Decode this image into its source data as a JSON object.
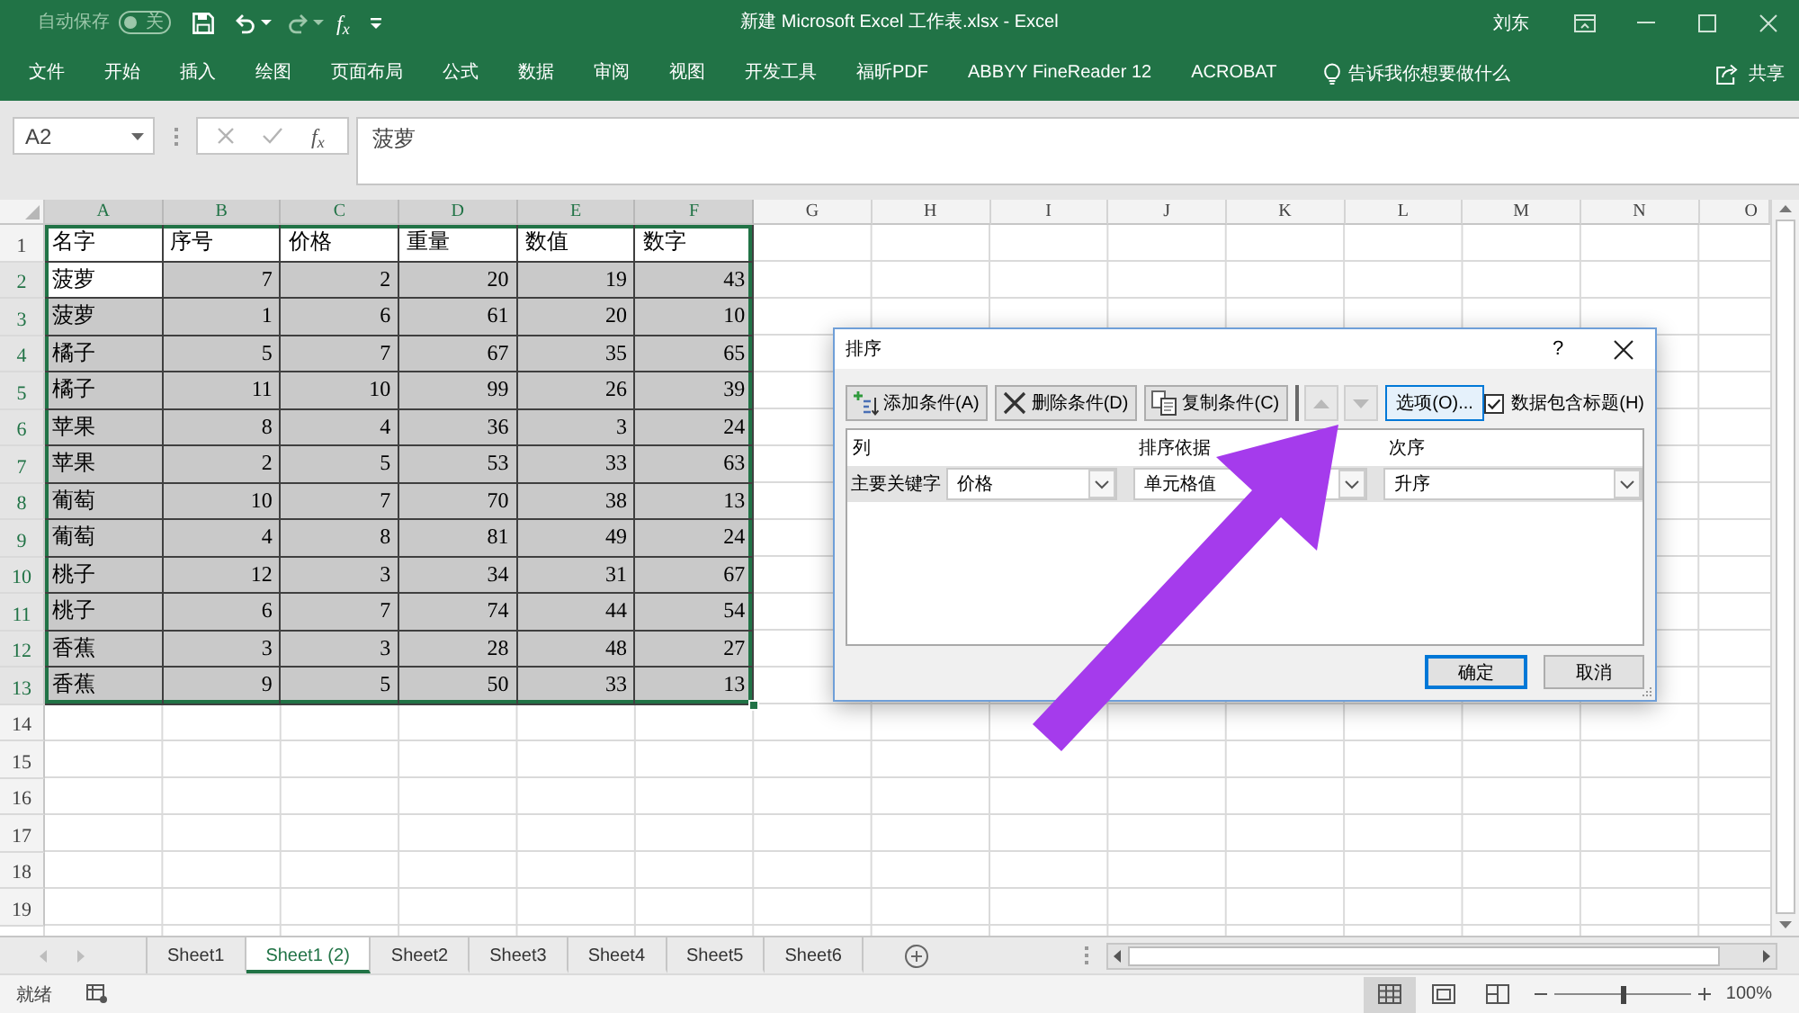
{
  "title_bar": {
    "autosave": {
      "label": "自动保存",
      "state_text": "关",
      "on": false
    },
    "function_label": "f$_{x}$",
    "title": "新建 Microsoft Excel 工作表.xlsx - Excel",
    "user": "刘东"
  },
  "ribbon": {
    "tabs": [
      "文件",
      "开始",
      "插入",
      "绘图",
      "页面布局",
      "公式",
      "数据",
      "审阅",
      "视图",
      "开发工具",
      "福昕PDF",
      "ABBYY FineReader 12",
      "ACROBAT"
    ],
    "tell_me": "告诉我你想要做什么",
    "share": "共享"
  },
  "formula_bar": {
    "name_box": "A2",
    "function_label": "f$_{x}$",
    "formula": "菠萝"
  },
  "sheet": {
    "columns": [
      {
        "label": "A",
        "selected": true,
        "kind": "text"
      },
      {
        "label": "B",
        "selected": true,
        "kind": "number"
      },
      {
        "label": "C",
        "selected": true,
        "kind": "number"
      },
      {
        "label": "D",
        "selected": true,
        "kind": "number"
      },
      {
        "label": "E",
        "selected": true,
        "kind": "number"
      },
      {
        "label": "F",
        "selected": true,
        "kind": "number"
      },
      {
        "label": "G",
        "selected": false
      },
      {
        "label": "H",
        "selected": false
      },
      {
        "label": "I",
        "selected": false
      },
      {
        "label": "J",
        "selected": false
      },
      {
        "label": "K",
        "selected": false
      },
      {
        "label": "L",
        "selected": false
      },
      {
        "label": "M",
        "selected": false
      },
      {
        "label": "N",
        "selected": false
      },
      {
        "label": "O",
        "selected": false
      }
    ],
    "rows": [
      {
        "number": "1",
        "kind": "header",
        "selected": false,
        "cells": [
          {
            "text": "名字",
            "selected": false
          },
          {
            "text": "序号",
            "selected": false
          },
          {
            "text": "价格",
            "selected": false
          },
          {
            "text": "重量",
            "selected": false
          },
          {
            "text": "数值",
            "selected": false
          },
          {
            "text": "数字",
            "selected": false
          }
        ]
      },
      {
        "number": "2",
        "kind": "data",
        "selected": true,
        "cells": [
          {
            "text": "菠萝",
            "selected": false
          },
          {
            "text": "7",
            "selected": true
          },
          {
            "text": "2",
            "selected": true
          },
          {
            "text": "20",
            "selected": true
          },
          {
            "text": "19",
            "selected": true
          },
          {
            "text": "43",
            "selected": true
          }
        ]
      },
      {
        "number": "3",
        "kind": "data",
        "selected": true,
        "cells": [
          {
            "text": "菠萝",
            "selected": true
          },
          {
            "text": "1",
            "selected": true
          },
          {
            "text": "6",
            "selected": true
          },
          {
            "text": "61",
            "selected": true
          },
          {
            "text": "20",
            "selected": true
          },
          {
            "text": "10",
            "selected": true
          }
        ]
      },
      {
        "number": "4",
        "kind": "data",
        "selected": true,
        "cells": [
          {
            "text": "橘子",
            "selected": true
          },
          {
            "text": "5",
            "selected": true
          },
          {
            "text": "7",
            "selected": true
          },
          {
            "text": "67",
            "selected": true
          },
          {
            "text": "35",
            "selected": true
          },
          {
            "text": "65",
            "selected": true
          }
        ]
      },
      {
        "number": "5",
        "kind": "data",
        "selected": true,
        "cells": [
          {
            "text": "橘子",
            "selected": true
          },
          {
            "text": "11",
            "selected": true
          },
          {
            "text": "10",
            "selected": true
          },
          {
            "text": "99",
            "selected": true
          },
          {
            "text": "26",
            "selected": true
          },
          {
            "text": "39",
            "selected": true
          }
        ]
      },
      {
        "number": "6",
        "kind": "data",
        "selected": true,
        "cells": [
          {
            "text": "苹果",
            "selected": true
          },
          {
            "text": "8",
            "selected": true
          },
          {
            "text": "4",
            "selected": true
          },
          {
            "text": "36",
            "selected": true
          },
          {
            "text": "3",
            "selected": true
          },
          {
            "text": "24",
            "selected": true
          }
        ]
      },
      {
        "number": "7",
        "kind": "data",
        "selected": true,
        "cells": [
          {
            "text": "苹果",
            "selected": true
          },
          {
            "text": "2",
            "selected": true
          },
          {
            "text": "5",
            "selected": true
          },
          {
            "text": "53",
            "selected": true
          },
          {
            "text": "33",
            "selected": true
          },
          {
            "text": "63",
            "selected": true
          }
        ]
      },
      {
        "number": "8",
        "kind": "data",
        "selected": true,
        "cells": [
          {
            "text": "葡萄",
            "selected": true
          },
          {
            "text": "10",
            "selected": true
          },
          {
            "text": "7",
            "selected": true
          },
          {
            "text": "70",
            "selected": true
          },
          {
            "text": "38",
            "selected": true
          },
          {
            "text": "13",
            "selected": true
          }
        ]
      },
      {
        "number": "9",
        "kind": "data",
        "selected": true,
        "cells": [
          {
            "text": "葡萄",
            "selected": true
          },
          {
            "text": "4",
            "selected": true
          },
          {
            "text": "8",
            "selected": true
          },
          {
            "text": "81",
            "selected": true
          },
          {
            "text": "49",
            "selected": true
          },
          {
            "text": "24",
            "selected": true
          }
        ]
      },
      {
        "number": "10",
        "kind": "data",
        "selected": true,
        "cells": [
          {
            "text": "桃子",
            "selected": true
          },
          {
            "text": "12",
            "selected": true
          },
          {
            "text": "3",
            "selected": true
          },
          {
            "text": "34",
            "selected": true
          },
          {
            "text": "31",
            "selected": true
          },
          {
            "text": "67",
            "selected": true
          }
        ]
      },
      {
        "number": "11",
        "kind": "data",
        "selected": true,
        "cells": [
          {
            "text": "桃子",
            "selected": true
          },
          {
            "text": "6",
            "selected": true
          },
          {
            "text": "7",
            "selected": true
          },
          {
            "text": "74",
            "selected": true
          },
          {
            "text": "44",
            "selected": true
          },
          {
            "text": "54",
            "selected": true
          }
        ]
      },
      {
        "number": "12",
        "kind": "data",
        "selected": true,
        "cells": [
          {
            "text": "香蕉",
            "selected": true
          },
          {
            "text": "3",
            "selected": true
          },
          {
            "text": "3",
            "selected": true
          },
          {
            "text": "28",
            "selected": true
          },
          {
            "text": "48",
            "selected": true
          },
          {
            "text": "27",
            "selected": true
          }
        ]
      },
      {
        "number": "13",
        "kind": "data",
        "selected": true,
        "cells": [
          {
            "text": "香蕉",
            "selected": true
          },
          {
            "text": "9",
            "selected": true
          },
          {
            "text": "5",
            "selected": true
          },
          {
            "text": "50",
            "selected": true
          },
          {
            "text": "33",
            "selected": true
          },
          {
            "text": "13",
            "selected": true
          }
        ]
      },
      {
        "number": "14",
        "kind": "empty",
        "selected": false
      },
      {
        "number": "15",
        "kind": "empty",
        "selected": false
      },
      {
        "number": "16",
        "kind": "empty",
        "selected": false
      },
      {
        "number": "17",
        "kind": "empty",
        "selected": false
      },
      {
        "number": "18",
        "kind": "empty",
        "selected": false
      },
      {
        "number": "19",
        "kind": "empty",
        "selected": false
      }
    ]
  },
  "sheet_tabs": [
    {
      "label": "Sheet1",
      "selected": false
    },
    {
      "label": "Sheet1 (2)",
      "selected": true
    },
    {
      "label": "Sheet2",
      "selected": false
    },
    {
      "label": "Sheet3",
      "selected": false
    },
    {
      "label": "Sheet4",
      "selected": false
    },
    {
      "label": "Sheet5",
      "selected": false
    },
    {
      "label": "Sheet6",
      "selected": false
    }
  ],
  "status_bar": {
    "status": "就绪",
    "views": [
      {
        "kind": "normal",
        "selected": true
      },
      {
        "kind": "page_layout",
        "selected": false
      },
      {
        "kind": "page_break",
        "selected": false
      }
    ],
    "zoom_slider": {
      "level": 0.5
    },
    "zoom": "100%"
  },
  "sort_dialog": {
    "title": "排序",
    "help": "?",
    "actions": [
      {
        "kind": "add",
        "label": "添加条件(A)"
      },
      {
        "kind": "delete",
        "label": "删除条件(D)"
      },
      {
        "kind": "copy",
        "label": "复制条件(C)"
      }
    ],
    "move_buttons": [
      {
        "kind": "up",
        "disabled": true
      },
      {
        "kind": "down",
        "disabled": true
      }
    ],
    "options": {
      "label": "选项(O)...",
      "focused": true
    },
    "has_headers": {
      "label": "数据包含标题(H)",
      "checked": true
    },
    "headers": [
      "列",
      "排序依据",
      "次序"
    ],
    "levels": [
      {
        "label": "主要关键字",
        "selected": true,
        "column": "价格",
        "sort_on": "单元格值",
        "order": "升序"
      }
    ],
    "ok": {
      "label": "确定",
      "default": true
    },
    "cancel": {
      "label": "取消"
    }
  }
}
